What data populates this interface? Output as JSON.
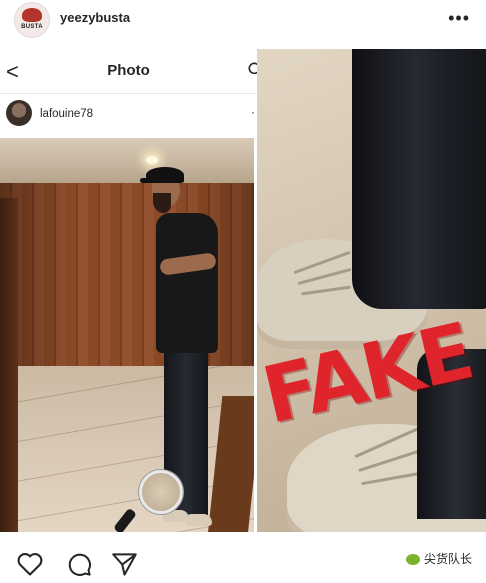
{
  "post": {
    "username": "yeezybusta",
    "avatar_text": "BUSTA",
    "more_icon": "more-horizontal-icon",
    "more_glyph": "•••"
  },
  "embedded_screenshot": {
    "nav_title": "Photo",
    "back_glyph": "<",
    "username": "lafouine78",
    "more_glyph": "·",
    "photo_description_icon": "magnifier-icon"
  },
  "zoom_panel": {
    "stamp_text": "FAKE",
    "stamp_color": "#e0242c"
  },
  "watermark": {
    "text": "尖货队长"
  },
  "colors": {
    "text": "#262626",
    "background": "#ffffff",
    "accent": "#e0242c"
  }
}
